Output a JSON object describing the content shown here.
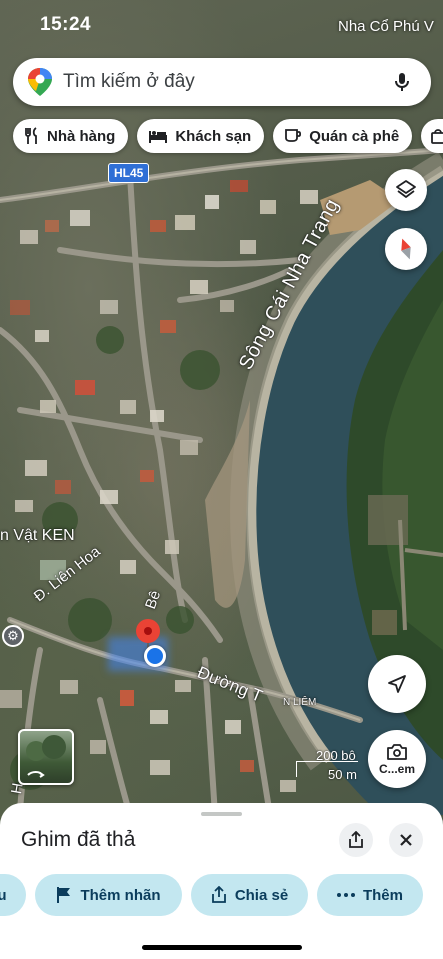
{
  "status_bar": {
    "time": "15:24",
    "location_hint": "Nha Cổ Phú V"
  },
  "search": {
    "placeholder": "Tìm kiếm ở đây"
  },
  "chips": [
    {
      "label": "Nhà hàng",
      "icon": "restaurant-icon"
    },
    {
      "label": "Khách sạn",
      "icon": "hotel-icon"
    },
    {
      "label": "Quán cà phê",
      "icon": "cafe-icon"
    }
  ],
  "map": {
    "road_badge": "HL45",
    "river_name": "Sông Cái Nha Trang",
    "place_ken": "n Vật KEN",
    "street_lien_hoa": "Đ. Liên Hoa",
    "street_be": "Bê",
    "street_duong": "Đường T",
    "place_lien": "N LIÊM",
    "street_h": "H"
  },
  "scale": {
    "imperial": "200 bộ",
    "metric": "50 m"
  },
  "lens": {
    "label": "C...em"
  },
  "sheet": {
    "title": "Ghim đã thả",
    "actions": [
      {
        "label": "u"
      },
      {
        "label": "Thêm nhãn",
        "icon": "flag-icon"
      },
      {
        "label": "Chia sẻ",
        "icon": "share-icon"
      },
      {
        "label": "Thêm",
        "icon": "more-icon"
      }
    ]
  },
  "colors": {
    "accent": "#1a73e8",
    "chip_bg": "#c3e7f0",
    "river": "#2f4f5a",
    "pin": "#ea4335"
  }
}
